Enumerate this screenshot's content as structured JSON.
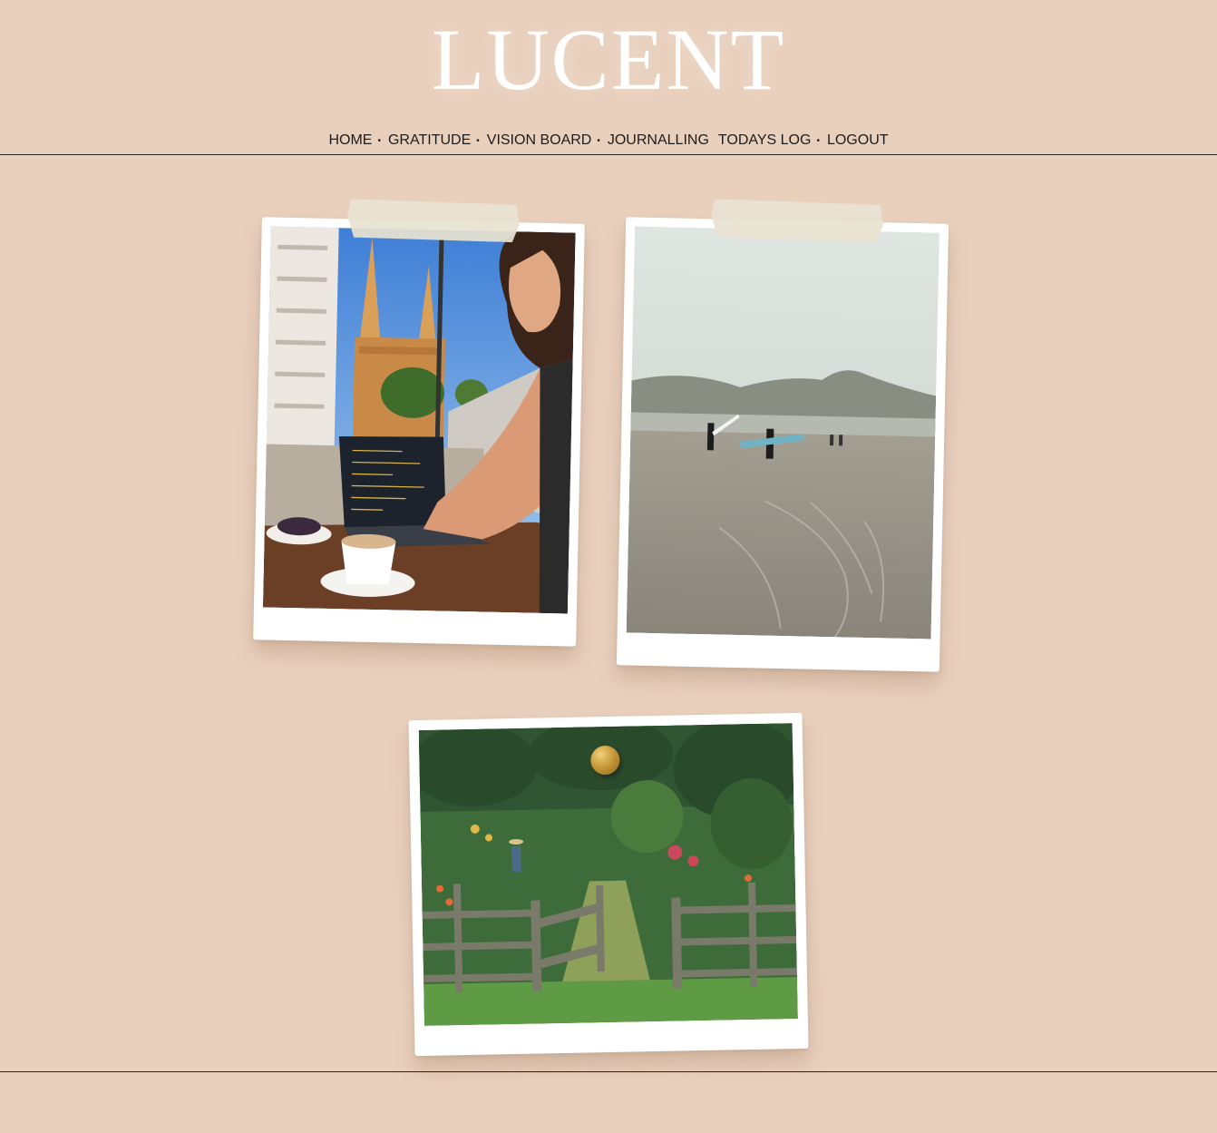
{
  "site": {
    "logo": "LUCENT"
  },
  "nav": {
    "items": [
      {
        "label": "HOME"
      },
      {
        "label": "GRATITUDE"
      },
      {
        "label": "VISION BOARD"
      },
      {
        "label": "JOURNALLING"
      },
      {
        "label": "TODAYS LOG"
      },
      {
        "label": "LOGOUT"
      }
    ],
    "separator": "•"
  },
  "colors": {
    "background": "#e9d0bd",
    "logo": "#ffffff",
    "frame": "#ffffff",
    "rule": "#222222"
  },
  "vision_board": {
    "photos": [
      {
        "subject": "woman-coding-at-cafe-photo",
        "fastener": "tape"
      },
      {
        "subject": "surfers-on-misty-beach-photo",
        "fastener": "tape"
      },
      {
        "subject": "vegetable-garden-photo",
        "fastener": "gold-pin"
      }
    ]
  }
}
